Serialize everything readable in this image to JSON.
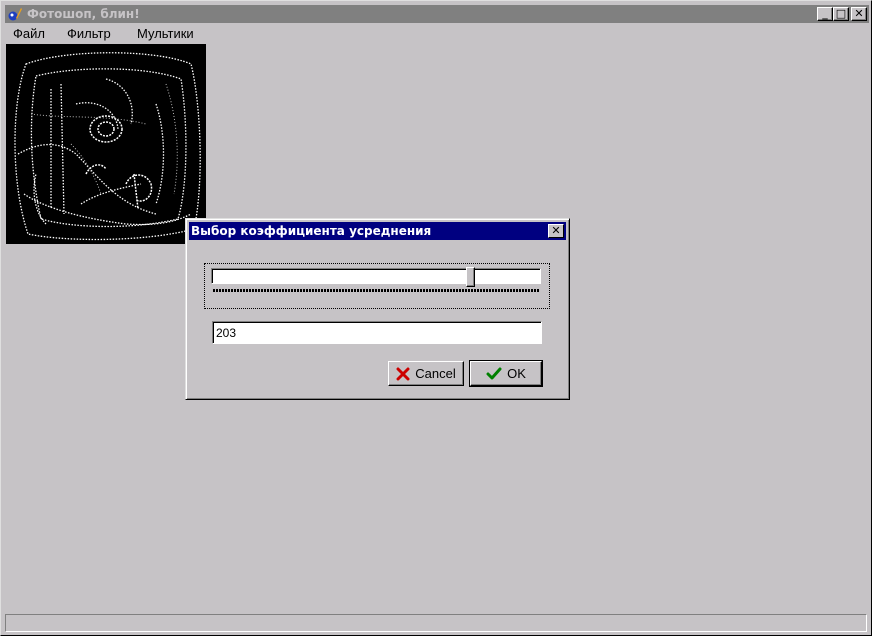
{
  "window": {
    "title": "Фотошоп, блин!",
    "controls": {
      "minimize": "_",
      "maximize": "□",
      "close": "✕"
    }
  },
  "menu": {
    "items": [
      {
        "label": "Файл"
      },
      {
        "label": "Фильтр"
      },
      {
        "label": "Мультики"
      }
    ]
  },
  "dialog": {
    "title": "Выбор коэффициента усреднения",
    "slider": {
      "min": 0,
      "max": 255,
      "value": 203
    },
    "value_field": "203",
    "buttons": {
      "cancel": "Cancel",
      "ok": "OK"
    }
  },
  "colors": {
    "face": "#c6c3c6",
    "active_title": "#000080",
    "inactive_title": "#808080",
    "cancel_icon": "#cc0000",
    "ok_icon": "#008000"
  },
  "icons": [
    "app-icon",
    "minimize-icon",
    "maximize-icon",
    "close-icon",
    "cancel-x-icon",
    "ok-check-icon"
  ]
}
